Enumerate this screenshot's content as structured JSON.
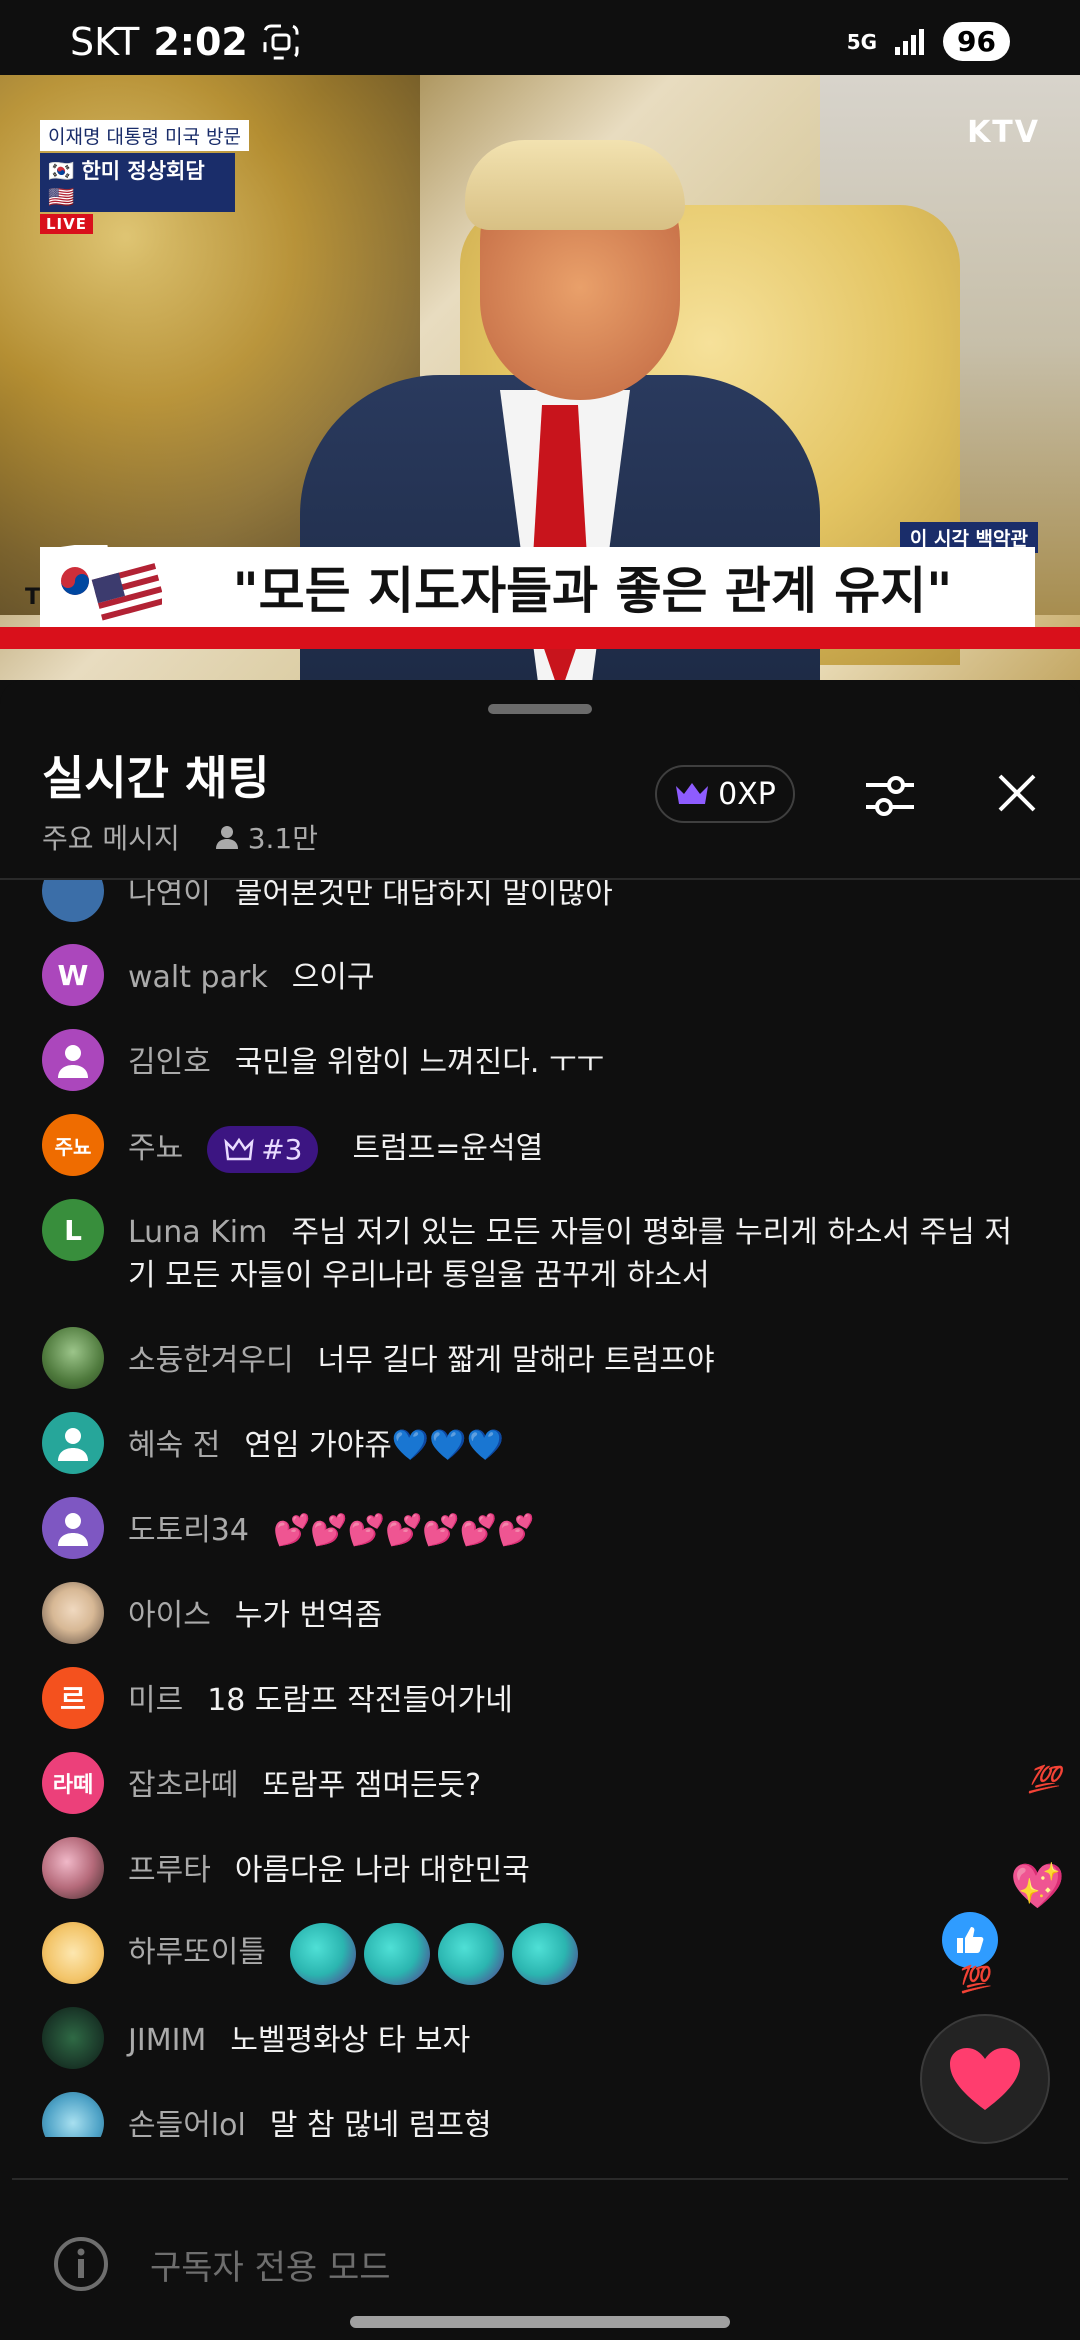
{
  "status_bar": {
    "carrier": "SKT",
    "time": "2:02",
    "network": "5G",
    "battery": "96"
  },
  "video": {
    "channel_logo": "KTV",
    "tag_line1": "이재명 대통령 미국 방문",
    "tag_line2": "한미 정상회담",
    "live_label": "LIVE",
    "location_tag": "이 시각 백악관",
    "chyron": "\"모든 지도자들과 좋은 관계 유지\"",
    "chyron_prefix": "T"
  },
  "chat": {
    "title": "실시간 채팅",
    "mode": "주요 메시지",
    "viewers": "3.1만",
    "xp": "0XP",
    "messages": [
      {
        "author": "나연이",
        "text": "물어본것만 대답하지 말이많아",
        "avatar_color": "#3b6ea8",
        "initial": ""
      },
      {
        "author": "walt park",
        "text": "으이구",
        "avatar_color": "#ab47bc",
        "initial": "W"
      },
      {
        "author": "김인호",
        "text": "국민을 위함이 느껴진다. ㅜㅜ",
        "avatar_color": "#ab47bc",
        "initial": ""
      },
      {
        "author": "주뇨",
        "badge": "#3",
        "text": "트럼프=윤석열",
        "avatar_color": "#ef6c00",
        "initial": "주뇨"
      },
      {
        "author": "Luna Kim",
        "text": "주님 저기 있는 모든 자들이 평화를 누리게 하소서 주님 저기 모든 자들이 우리나라 통일울 꿈꾸게 하소서",
        "avatar_color": "#388e3c",
        "initial": "L"
      },
      {
        "author": "소듕한겨우디",
        "text": "너무 길다 짧게 말해라 트럼프야",
        "avatar_color": "#6b8a5a",
        "initial": ""
      },
      {
        "author": "혜숙 전",
        "text": "연임 가야쥬💙💙💙",
        "avatar_color": "#26a69a",
        "initial": ""
      },
      {
        "author": "도토리34",
        "text": "💕💕💕💕💕💕💕",
        "avatar_color": "#7e57c2",
        "initial": ""
      },
      {
        "author": "아이스",
        "text": "누가 번역좀",
        "avatar_color": "#9e9e9e",
        "initial": ""
      },
      {
        "author": "미르",
        "text": "18 도람프 작전들어가네",
        "avatar_color": "#f4511e",
        "initial": "르"
      },
      {
        "author": "잡초라떼",
        "text": "또람푸 잼며든듯?",
        "avatar_color": "#ec407a",
        "initial": "라떼"
      },
      {
        "author": "프루타",
        "text": "아름다운 나라 대한민국",
        "avatar_color": "#8d6e63",
        "initial": ""
      },
      {
        "author": "하루또이틀",
        "text": "",
        "avatar_color": "#f3c56a",
        "initial": ""
      },
      {
        "author": "JIMIM",
        "text": "노벨평화상 타 보자",
        "avatar_color": "#1b3a2a",
        "initial": ""
      },
      {
        "author": "손들어lol",
        "text": "말 참 많네 럼프형",
        "avatar_color": "#4fa3c7",
        "initial": ""
      }
    ],
    "input_placeholder": "구독자 전용 모드"
  },
  "colors": {
    "background": "#0f0f0f",
    "author_text": "#aaaaaa",
    "badge_bg": "#3c1582",
    "heart": "#ff3d6e"
  }
}
